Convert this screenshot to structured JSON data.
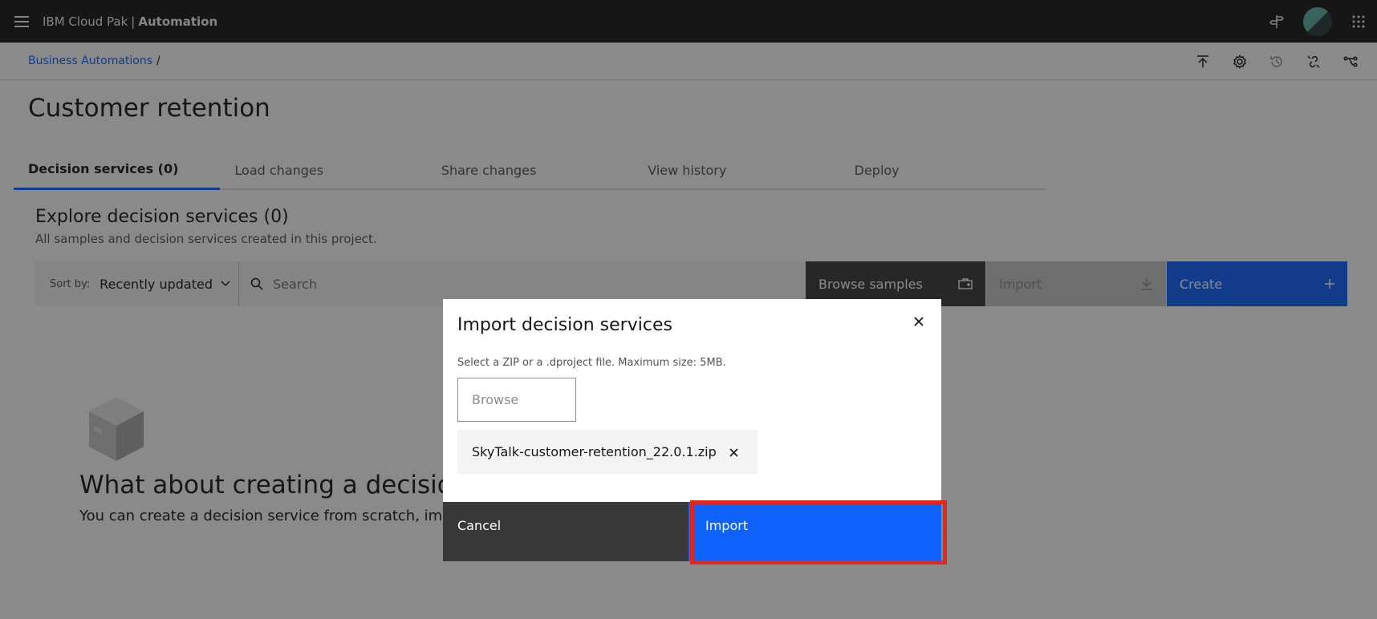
{
  "shell": {
    "brand_prefix": "IBM Cloud Pak",
    "brand_separator": "|",
    "brand_product": "Automation"
  },
  "breadcrumb": {
    "items": [
      "Business Automations"
    ],
    "separator": "/"
  },
  "page": {
    "title": "Customer retention"
  },
  "tabs": [
    {
      "label": "Decision services (0)",
      "active": true
    },
    {
      "label": "Load changes",
      "active": false
    },
    {
      "label": "Share changes",
      "active": false
    },
    {
      "label": "View history",
      "active": false
    },
    {
      "label": "Deploy",
      "active": false
    }
  ],
  "explore": {
    "heading": "Explore decision services (0)",
    "subtitle": "All samples and decision services created in this project."
  },
  "actionbar": {
    "sort_label": "Sort by:",
    "sort_value": "Recently updated",
    "search_placeholder": "Search",
    "browse_label": "Browse samples",
    "import_label": "Import",
    "create_label": "Create"
  },
  "empty_state": {
    "heading": "What about creating a decision",
    "text": "You can create a decision service from scratch, import a"
  },
  "modal": {
    "title": "Import decision services",
    "help_text": "Select a ZIP or a .dproject file. Maximum size: 5MB.",
    "browse_label": "Browse",
    "file_name": "SkyTalk-customer-retention_22.0.1.zip",
    "cancel_label": "Cancel",
    "import_label": "Import"
  },
  "colors": {
    "shell_bg": "#161616",
    "primary": "#0f62fe",
    "secondary_button": "#393939",
    "highlight": "#e0271b"
  },
  "icons": [
    "menu-icon",
    "signpost-icon",
    "app-switcher-icon",
    "upload-icon",
    "settings-icon",
    "history-icon",
    "disconnect-icon",
    "branch-icon",
    "chevron-down-icon",
    "search-icon",
    "samples-icon",
    "download-icon",
    "add-icon",
    "close-icon",
    "box-icon"
  ]
}
